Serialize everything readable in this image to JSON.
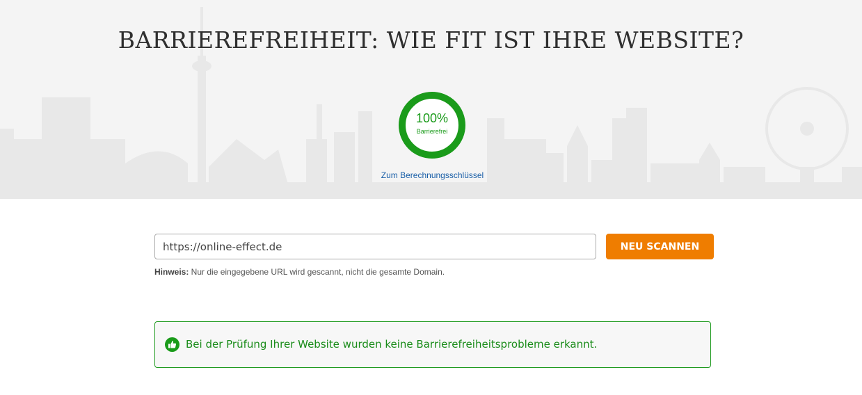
{
  "hero": {
    "title": "BARRIEREFREIHEIT: WIE FIT IST IHRE WEBSITE?",
    "score": {
      "value": "100%",
      "caption": "Barrierefrei",
      "fraction": 1.0
    },
    "calc_link": "Zum Berechnungsschlüssel"
  },
  "scan_form": {
    "url_value": "https://online-effect.de",
    "button_label": "NEU SCANNEN",
    "hint_label": "Hinweis:",
    "hint_text": " Nur die eingegebene URL wird gescannt, nicht die gesamte Domain."
  },
  "result": {
    "icon": "thumbs-up-icon",
    "message": "Bei der Prüfung Ihrer Website wurden keine Barrierefreiheitsprobleme erkannt."
  },
  "colors": {
    "accent": "#ef7d00",
    "success": "#1a9b1a",
    "link": "#1a5fa8",
    "hero_bg": "#f4f4f4"
  }
}
